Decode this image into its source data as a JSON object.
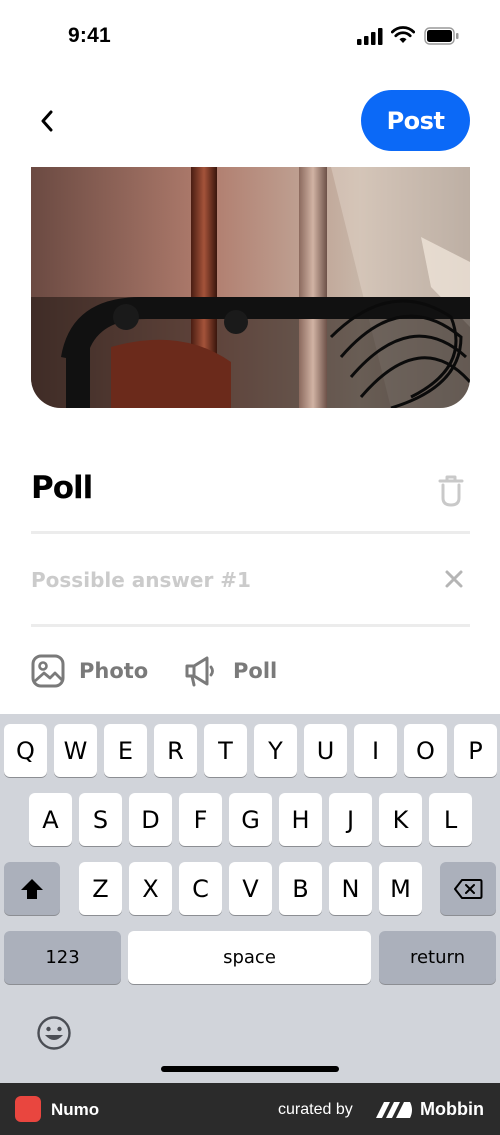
{
  "status_bar": {
    "time": "9:41"
  },
  "header": {
    "post_label": "Post"
  },
  "poll": {
    "title": "Poll",
    "answer_placeholder": "Possible answer #1",
    "answer_value": ""
  },
  "toolbar": {
    "photo_label": "Photo",
    "poll_label": "Poll"
  },
  "keyboard": {
    "row1": [
      "Q",
      "W",
      "E",
      "R",
      "T",
      "Y",
      "U",
      "I",
      "O",
      "P"
    ],
    "row2": [
      "A",
      "S",
      "D",
      "F",
      "G",
      "H",
      "J",
      "K",
      "L"
    ],
    "row3": [
      "Z",
      "X",
      "C",
      "V",
      "B",
      "N",
      "M"
    ],
    "numbers_label": "123",
    "space_label": "space",
    "return_label": "return"
  },
  "footer": {
    "app_name": "Numo",
    "curated_by": "curated by",
    "brand": "Mobbin"
  },
  "colors": {
    "accent": "#0B69F7",
    "muted": "#7a7a7a",
    "placeholder": "#cbcbcb"
  }
}
